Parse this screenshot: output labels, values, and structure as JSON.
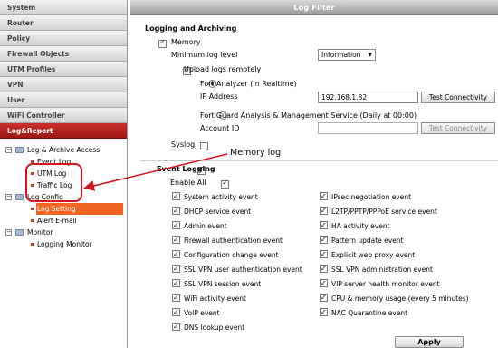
{
  "sidebar": {
    "nav": [
      "System",
      "Router",
      "Policy",
      "Firewall Objects",
      "UTM Profiles",
      "VPN",
      "User",
      "WiFi Controller",
      "Log&Report"
    ],
    "tree": {
      "log_archive_access": "Log & Archive Access",
      "event_log": "Event Log",
      "utm_log": "UTM Log",
      "traffic_log": "Traffic Log",
      "log_config": "Log Config",
      "log_setting": "Log Setting",
      "alert_email": "Alert E-mail",
      "monitor": "Monitor",
      "logging_monitor": "Logging Monitor"
    }
  },
  "header": {
    "title": "Log Filter"
  },
  "logging_archiving": {
    "section_title": "Logging and Archiving",
    "memory_label": "Memory",
    "min_log_level_label": "Minimum log level",
    "min_log_level_value": "Information",
    "upload_label": "Upload logs remotely",
    "fortianalyzer_label": "FortiAnalyzer (In Realtime)",
    "ip_label": "IP Address",
    "ip_value": "192.168.1.82",
    "test_connectivity": "Test Connectivity",
    "fortiguard_label": "FortiGuard Analysis & Management Service (Daily at 00:00)",
    "account_id_label": "Account ID",
    "account_id_value": "",
    "test_connectivity_2": "Test Connectivity",
    "syslog_label": "Syslog"
  },
  "event_logging": {
    "section_title": "Event Logging",
    "enable_all": "Enable All",
    "left": [
      "System activity event",
      "DHCP service event",
      "Admin event",
      "Firewall authentication event",
      "Configuration change event",
      "SSL VPN user authentication event",
      "SSL VPN session event",
      "WiFi activity event",
      "VoIP event",
      "DNS lookup event"
    ],
    "right": [
      "IPsec negotiation event",
      "L2TP/PPTP/PPPoE service event",
      "HA activity event",
      "Pattern update event",
      "Explicit web proxy event",
      "SSL VPN administration event",
      "VIP server health monitor event",
      "CPU & memory usage (every 5 minutes)",
      "NAC Quarantine event"
    ]
  },
  "apply_label": "Apply",
  "annotation": {
    "text": "Memory log",
    "color": "#d4141f"
  },
  "colors": {
    "active_nav": "#b0201c",
    "selected_tree": "#f26522"
  }
}
